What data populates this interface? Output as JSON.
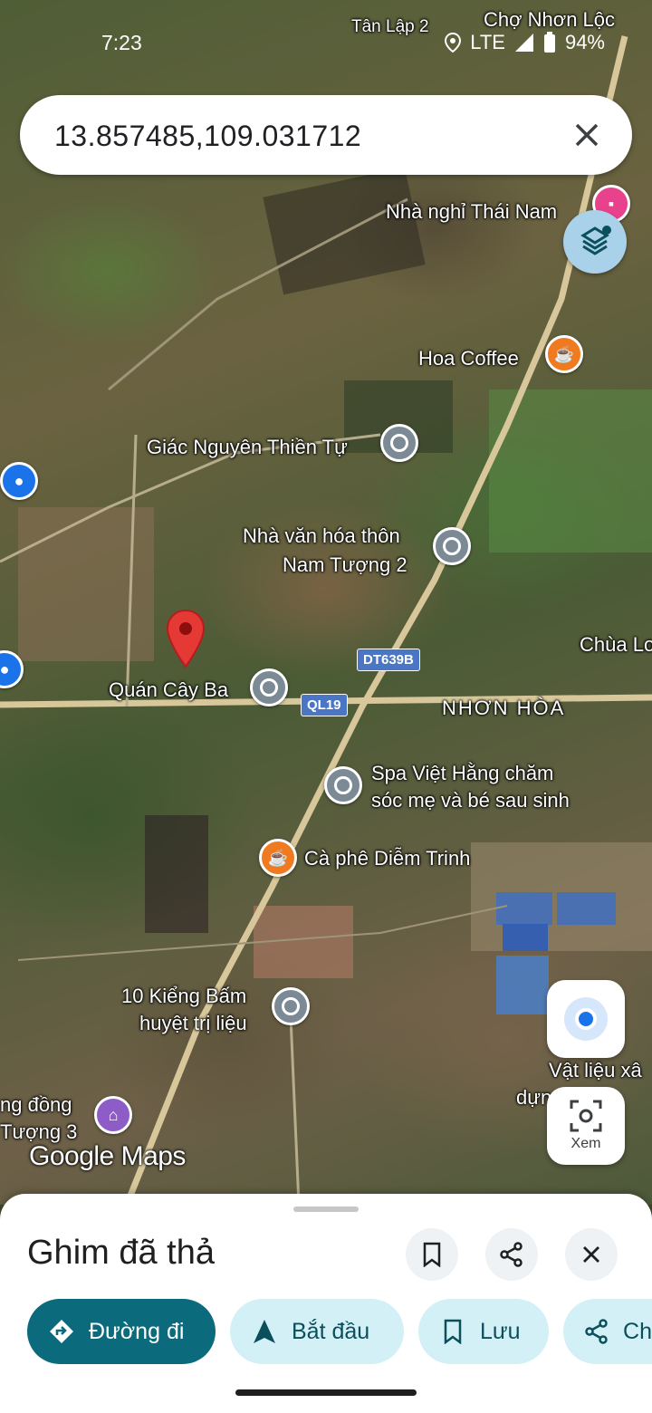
{
  "status_bar": {
    "time": "7:23",
    "network": "LTE",
    "battery": "94%"
  },
  "search": {
    "query": "13.857485,109.031712"
  },
  "map": {
    "labels": {
      "tan_lap": "Tân Lập 2",
      "cho_nhon_loc": "Chợ Nhơn Lộc",
      "nha_nghi": "Nhà nghỉ Thái Nam",
      "hoa_coffee": "Hoa Coffee",
      "giac_nguyen": "Giác Nguyên Thiền Tự",
      "nha_van_hoa_1": "Nhà văn hóa thôn",
      "nha_van_hoa_2": "Nam Tượng 2",
      "chua": "Chùa Lo",
      "quan_cay_ba": "Quán Cây Ba",
      "nhon_hoa": "NHƠN HÒA",
      "spa_1": "Spa Việt Hằng chăm",
      "spa_2": "sóc mẹ và bé sau sinh",
      "ca_phe": "Cà phê Diễm Trinh",
      "kieng_1": "10 Kiểng Bấm",
      "kieng_2": "huyệt trị liệu",
      "vat_lieu_1": "Vật liệu xâ",
      "vat_lieu_2": "dựng   Th",
      "cong_dong_1": "ng đồng",
      "cong_dong_2": "Tượng 3"
    },
    "road_shields": {
      "dt": "DT639B",
      "ql": "QL19"
    },
    "logo": "Google Maps",
    "xem_label": "Xem"
  },
  "sheet": {
    "title": "Ghim đã thả",
    "chips": {
      "directions": "Đường đi",
      "start": "Bắt đầu",
      "save": "Lưu",
      "share": "Ch"
    }
  }
}
